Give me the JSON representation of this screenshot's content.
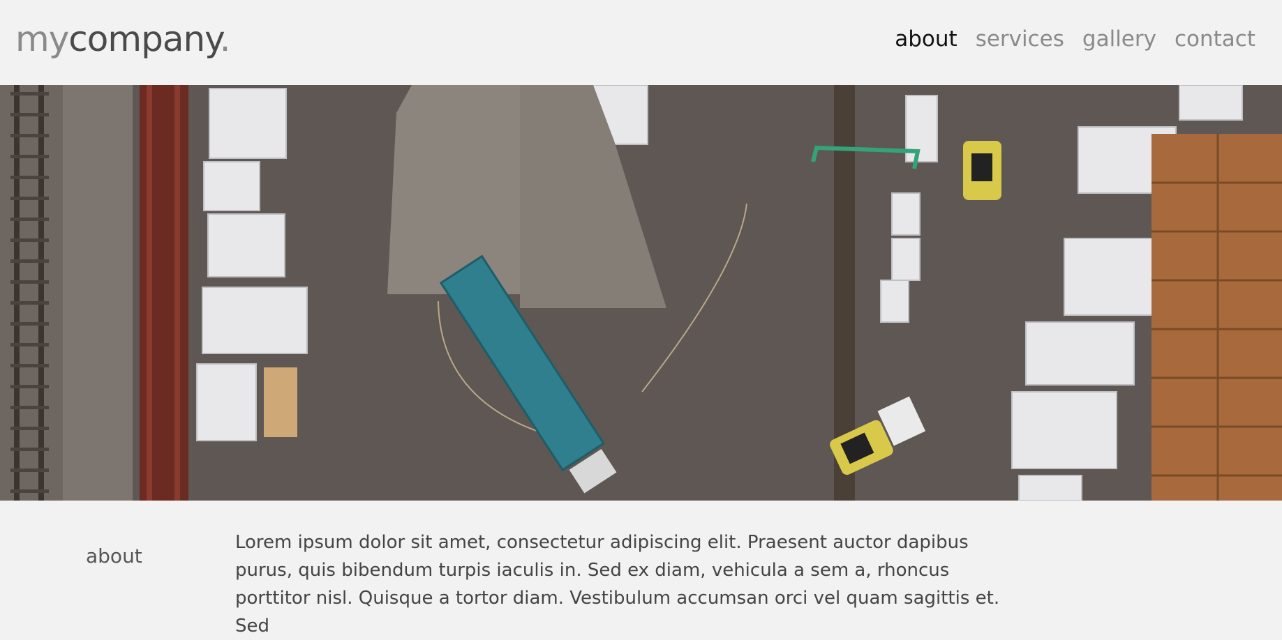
{
  "header": {
    "logo_part1": "my",
    "logo_part2": "company",
    "logo_dot": "."
  },
  "nav": {
    "items": [
      {
        "label": "about",
        "active": true
      },
      {
        "label": "services",
        "active": false
      },
      {
        "label": "gallery",
        "active": false
      },
      {
        "label": "contact",
        "active": false
      }
    ]
  },
  "hero": {
    "description": "aerial-photo"
  },
  "about": {
    "label": "about",
    "text": "Lorem ipsum dolor sit amet, consectetur adipiscing elit. Praesent auctor dapibus purus, quis bibendum turpis iaculis in. Sed ex diam, vehicula a sem a, rhoncus porttitor nisl. Quisque a tortor diam. Vestibulum accumsan orci vel quam sagittis et. Sed"
  },
  "colors": {
    "background": "#f2f2f2",
    "nav_inactive": "#8a8a8a",
    "nav_active": "#111111",
    "truck_trailer": "#2f7f8f",
    "forklift": "#d9c94a"
  }
}
